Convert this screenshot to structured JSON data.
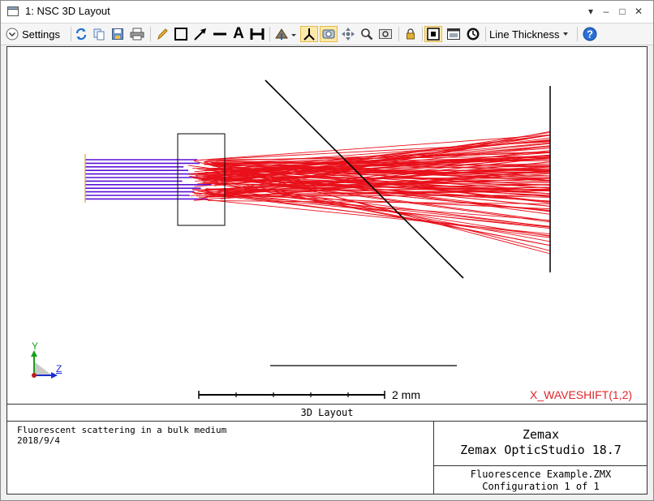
{
  "window": {
    "title": "1: NSC 3D Layout",
    "buttons": {
      "menu": "▾",
      "minimize": "–",
      "maximize": "□",
      "close": "✕"
    }
  },
  "toolbar": {
    "settings_label": "Settings",
    "line_thickness_label": "Line Thickness",
    "text_tool_glyph": "A"
  },
  "layout": {
    "scale_bar_label": "2 mm",
    "wavelength_label": "X_WAVESHIFT(1,2)",
    "axis_y": "Y",
    "axis_z": "Z",
    "colors": {
      "input_rays": "#5a10d8",
      "scattered_rays": "#e8101a",
      "geometry": "#000000"
    }
  },
  "footer": {
    "caption": "3D Layout",
    "description": "Fluorescent scattering in a bulk medium",
    "date": "2018/9/4",
    "company": "Zemax",
    "product": "Zemax OpticStudio 18.7",
    "file_name": "Fluorescence Example.ZMX",
    "configuration": "Configuration 1 of 1"
  }
}
